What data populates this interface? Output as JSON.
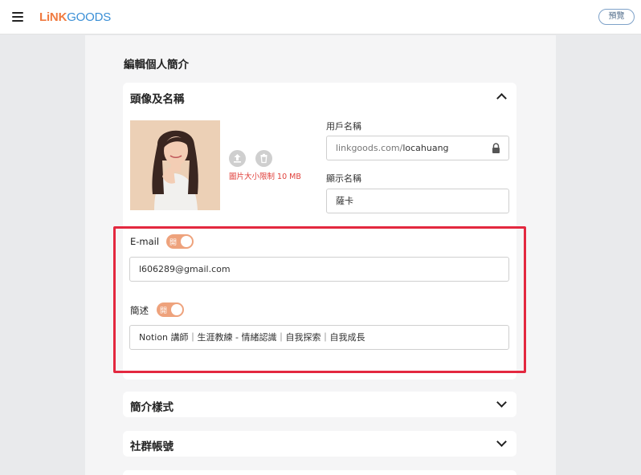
{
  "topbar": {
    "logo_part1": "LiNK",
    "logo_part2": "GOODS",
    "preview_label": "預覽"
  },
  "page": {
    "title": "編輯個人簡介"
  },
  "profile_card": {
    "title": "頭像及名稱",
    "upload_limit_note": "圖片大小限制 10 MB",
    "username_label": "用戶名稱",
    "username_domain": "linkgoods.com/",
    "username_value": "locahuang",
    "display_name_label": "顯示名稱",
    "display_name_value": "薩卡",
    "email_label": "E-mail",
    "email_toggle_label": "開",
    "email_value": "l606289@gmail.com",
    "bio_label": "簡述",
    "bio_toggle_label": "開",
    "bio_value": "Notion 講師｜生涯教練 - 情緒認識｜自我探索｜自我成長"
  },
  "sections": [
    {
      "title": "簡介樣式"
    },
    {
      "title": "社群帳號"
    }
  ],
  "colors": {
    "accent_orange": "#f07a3f",
    "accent_blue": "#3a8fd6",
    "toggle_on": "#eea27c",
    "highlight_red": "#e3283f",
    "warning_red": "#e0413c"
  },
  "icons": [
    "menu-icon",
    "upload-icon",
    "trash-icon",
    "lock-icon",
    "chevron-up-icon",
    "chevron-down-icon"
  ]
}
